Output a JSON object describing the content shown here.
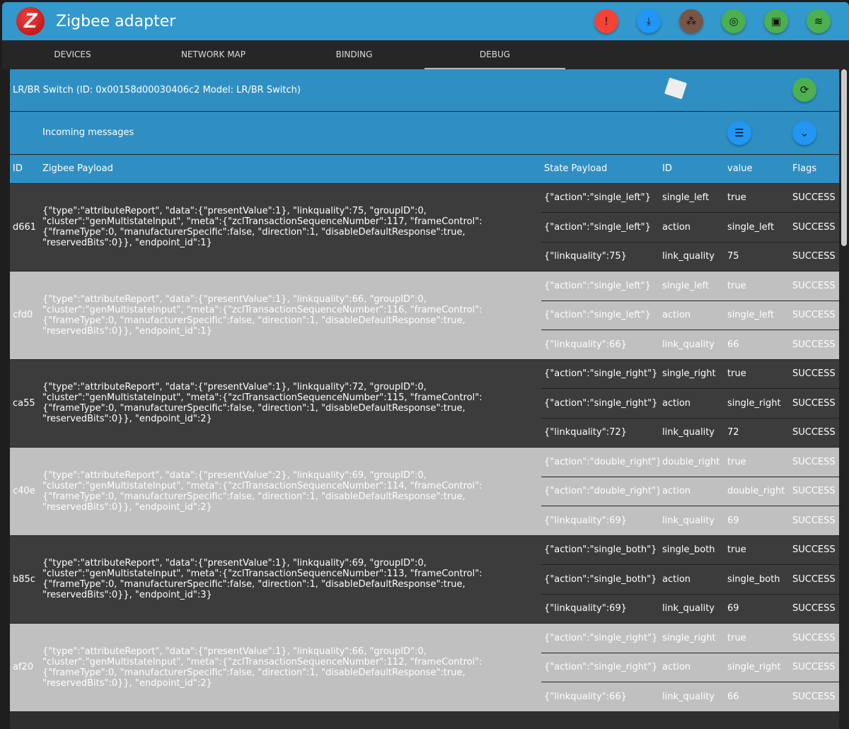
{
  "app": {
    "title": "Zigbee adapter",
    "logo": "Z"
  },
  "header_buttons": [
    {
      "name": "alert-message-icon",
      "color": "#f44336",
      "glyph": "!"
    },
    {
      "name": "device-download-icon",
      "color": "#2196f3",
      "glyph": "⤓"
    },
    {
      "name": "hub-icon",
      "color": "#795548",
      "glyph": "⁂"
    },
    {
      "name": "wifi-tethering-icon",
      "color": "#4caf50",
      "glyph": "◎"
    },
    {
      "name": "select-area-icon",
      "color": "#4caf50",
      "glyph": "▣"
    },
    {
      "name": "signal-icon",
      "color": "#4caf50",
      "glyph": "≋"
    }
  ],
  "tabs": [
    "DEVICES",
    "NETWORK MAP",
    "BINDING",
    "DEBUG"
  ],
  "device": {
    "label": "LR/BR Switch (ID: 0x00158d00030406c2 Model: LR/BR Switch)"
  },
  "incoming": {
    "label": "Incoming messages"
  },
  "columns": [
    "ID",
    "Zigbee Payload",
    "State Payload",
    "ID",
    "value",
    "Flags"
  ],
  "messages": [
    {
      "id": "d661",
      "payload": "{\"type\":\"attributeReport\", \"data\":{\"presentValue\":1}, \"linkquality\":75, \"groupID\":0, \"cluster\":\"genMultistateInput\", \"meta\":{\"zclTransactionSequenceNumber\":117, \"frameControl\":{\"frameType\":0, \"manufacturerSpecific\":false, \"direction\":1, \"disableDefaultResponse\":true, \"reservedBits\":0}}, \"endpoint_id\":1}",
      "states": [
        [
          "{\"action\":\"single_left\"}",
          "single_left",
          "true",
          "SUCCESS"
        ],
        [
          "{\"action\":\"single_left\"}",
          "action",
          "single_left",
          "SUCCESS"
        ],
        [
          "{\"linkquality\":75}",
          "link_quality",
          "75",
          "SUCCESS"
        ]
      ]
    },
    {
      "id": "cfd0",
      "payload": "{\"type\":\"attributeReport\", \"data\":{\"presentValue\":1}, \"linkquality\":66, \"groupID\":0, \"cluster\":\"genMultistateInput\", \"meta\":{\"zclTransactionSequenceNumber\":116, \"frameControl\":{\"frameType\":0, \"manufacturerSpecific\":false, \"direction\":1, \"disableDefaultResponse\":true, \"reservedBits\":0}}, \"endpoint_id\":1}",
      "states": [
        [
          "{\"action\":\"single_left\"}",
          "single_left",
          "true",
          "SUCCESS"
        ],
        [
          "{\"action\":\"single_left\"}",
          "action",
          "single_left",
          "SUCCESS"
        ],
        [
          "{\"linkquality\":66}",
          "link_quality",
          "66",
          "SUCCESS"
        ]
      ]
    },
    {
      "id": "ca55",
      "payload": "{\"type\":\"attributeReport\", \"data\":{\"presentValue\":1}, \"linkquality\":72, \"groupID\":0, \"cluster\":\"genMultistateInput\", \"meta\":{\"zclTransactionSequenceNumber\":115, \"frameControl\":{\"frameType\":0, \"manufacturerSpecific\":false, \"direction\":1, \"disableDefaultResponse\":true, \"reservedBits\":0}}, \"endpoint_id\":2}",
      "states": [
        [
          "{\"action\":\"single_right\"}",
          "single_right",
          "true",
          "SUCCESS"
        ],
        [
          "{\"action\":\"single_right\"}",
          "action",
          "single_right",
          "SUCCESS"
        ],
        [
          "{\"linkquality\":72}",
          "link_quality",
          "72",
          "SUCCESS"
        ]
      ]
    },
    {
      "id": "c40e",
      "payload": "{\"type\":\"attributeReport\", \"data\":{\"presentValue\":2}, \"linkquality\":69, \"groupID\":0, \"cluster\":\"genMultistateInput\", \"meta\":{\"zclTransactionSequenceNumber\":114, \"frameControl\":{\"frameType\":0, \"manufacturerSpecific\":false, \"direction\":1, \"disableDefaultResponse\":true, \"reservedBits\":0}}, \"endpoint_id\":2}",
      "states": [
        [
          "{\"action\":\"double_right\"}",
          "double_right",
          "true",
          "SUCCESS"
        ],
        [
          "{\"action\":\"double_right\"}",
          "action",
          "double_right",
          "SUCCESS"
        ],
        [
          "{\"linkquality\":69}",
          "link_quality",
          "69",
          "SUCCESS"
        ]
      ]
    },
    {
      "id": "b85c",
      "payload": "{\"type\":\"attributeReport\", \"data\":{\"presentValue\":1}, \"linkquality\":69, \"groupID\":0, \"cluster\":\"genMultistateInput\", \"meta\":{\"zclTransactionSequenceNumber\":113, \"frameControl\":{\"frameType\":0, \"manufacturerSpecific\":false, \"direction\":1, \"disableDefaultResponse\":true, \"reservedBits\":0}}, \"endpoint_id\":3}",
      "states": [
        [
          "{\"action\":\"single_both\"}",
          "single_both",
          "true",
          "SUCCESS"
        ],
        [
          "{\"action\":\"single_both\"}",
          "action",
          "single_both",
          "SUCCESS"
        ],
        [
          "{\"linkquality\":69}",
          "link_quality",
          "69",
          "SUCCESS"
        ]
      ]
    },
    {
      "id": "af20",
      "payload": "{\"type\":\"attributeReport\", \"data\":{\"presentValue\":1}, \"linkquality\":66, \"groupID\":0, \"cluster\":\"genMultistateInput\", \"meta\":{\"zclTransactionSequenceNumber\":112, \"frameControl\":{\"frameType\":0, \"manufacturerSpecific\":false, \"direction\":1, \"disableDefaultResponse\":true, \"reservedBits\":0}}, \"endpoint_id\":2}",
      "states": [
        [
          "{\"action\":\"single_right\"}",
          "single_right",
          "true",
          "SUCCESS"
        ],
        [
          "{\"action\":\"single_right\"}",
          "action",
          "single_right",
          "SUCCESS"
        ],
        [
          "{\"linkquality\":66}",
          "link_quality",
          "66",
          "SUCCESS"
        ]
      ]
    }
  ]
}
